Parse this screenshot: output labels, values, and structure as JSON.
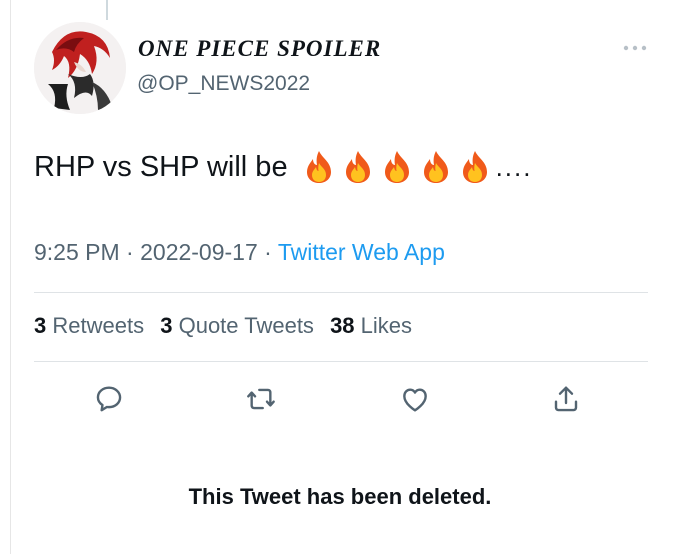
{
  "tweet": {
    "display_name": "ONE PIECE SPOILER",
    "handle": "@OP_NEWS2022",
    "text": "RHP vs SHP will be",
    "emoji_icon": "fire-emoji",
    "fire_count": 5,
    "trailing": "....",
    "time": "9:25 PM",
    "date": "2022-09-17",
    "source": "Twitter Web App",
    "separator": "·"
  },
  "stats": {
    "retweets_count": "3",
    "retweets_label": "Retweets",
    "quotes_count": "3",
    "quotes_label": "Quote Tweets",
    "likes_count": "38",
    "likes_label": "Likes"
  },
  "actions": [
    "reply-icon",
    "retweet-icon",
    "like-icon",
    "share-icon"
  ],
  "notice": "This Tweet has been deleted.",
  "colors": {
    "accent": "#1d9bf0",
    "muted": "#536471",
    "text": "#0f1419"
  }
}
